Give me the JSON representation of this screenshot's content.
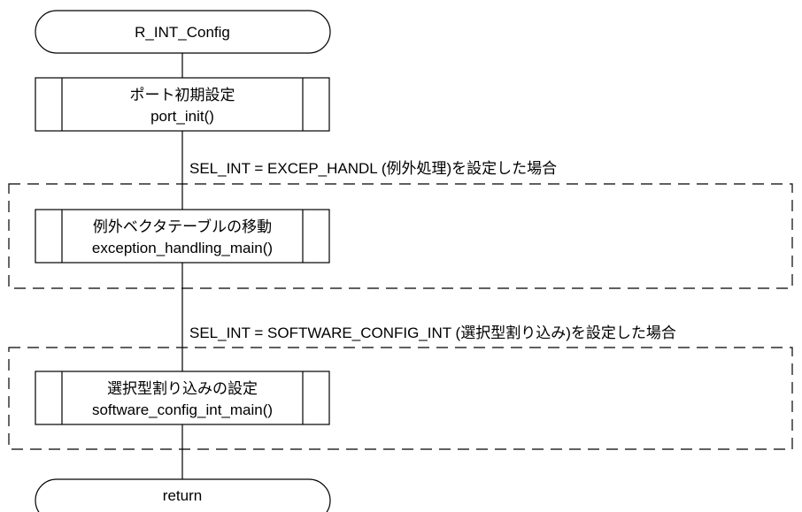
{
  "start": {
    "label": "R_INT_Config"
  },
  "end": {
    "label": "return"
  },
  "steps": [
    {
      "title": "ポート初期設定",
      "func": "port_init()"
    },
    {
      "title": "例外ベクタテーブルの移動",
      "func": "exception_handling_main()"
    },
    {
      "title": "選択型割り込みの設定",
      "func": "software_config_int_main()"
    }
  ],
  "conditions": [
    {
      "label": "SEL_INT = EXCEP_HANDL (例外処理)を設定した場合"
    },
    {
      "label": "SEL_INT = SOFTWARE_CONFIG_INT (選択型割り込み)を設定した場合"
    }
  ]
}
